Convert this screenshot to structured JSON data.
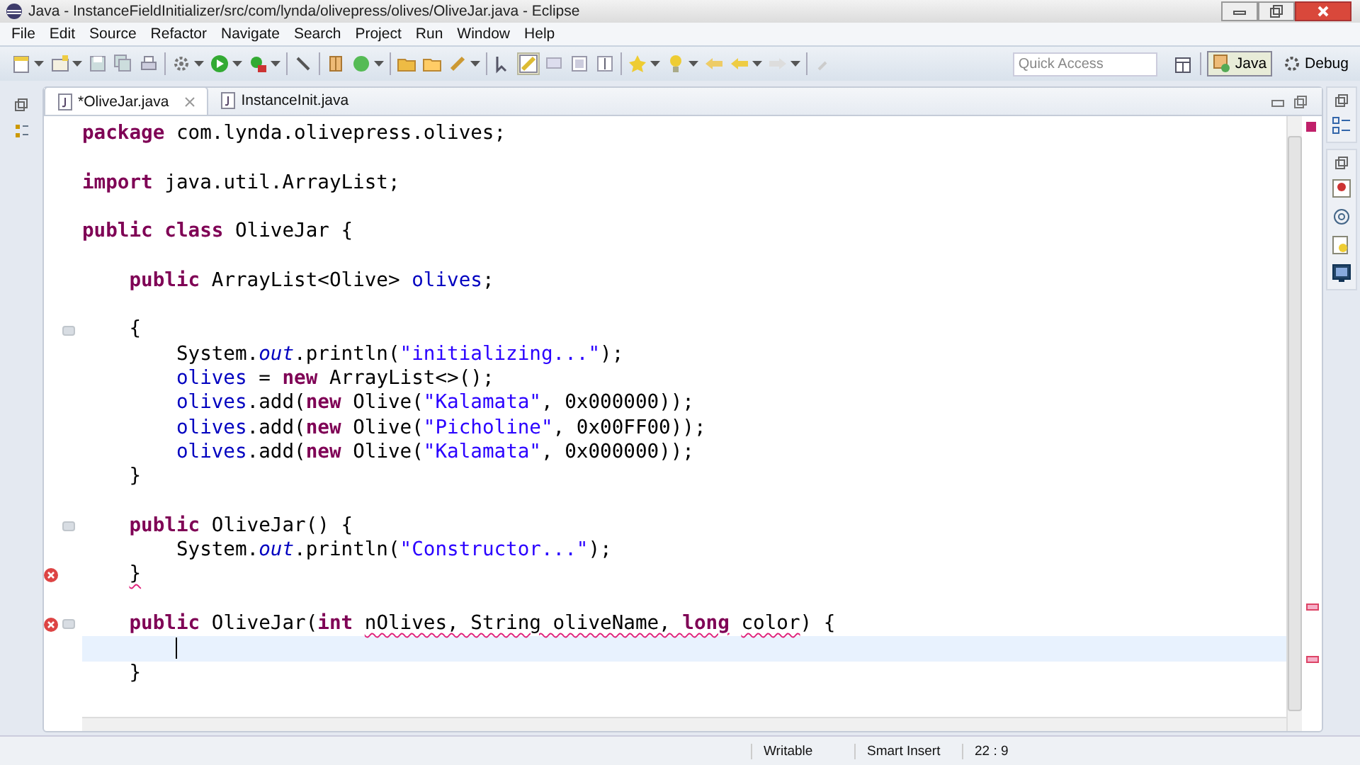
{
  "window": {
    "title": "Java - InstanceFieldInitializer/src/com/lynda/olivepress/olives/OliveJar.java - Eclipse"
  },
  "menu": [
    "File",
    "Edit",
    "Source",
    "Refactor",
    "Navigate",
    "Search",
    "Project",
    "Run",
    "Window",
    "Help"
  ],
  "quick_access": {
    "placeholder": "Quick Access"
  },
  "perspectives": [
    {
      "label": "Java",
      "selected": true
    },
    {
      "label": "Debug",
      "selected": false
    }
  ],
  "tabs": [
    {
      "label": "*OliveJar.java",
      "selected": true
    },
    {
      "label": "InstanceInit.java",
      "selected": false
    }
  ],
  "code_lines": [
    {
      "kind": "code",
      "fold": false,
      "error": false,
      "current": false,
      "tokens": [
        {
          "text": "package",
          "kind": "keyword"
        },
        {
          "text": " com.lynda.olivepress.olives;",
          "kind": "plain"
        }
      ]
    },
    {
      "kind": "blank"
    },
    {
      "kind": "code",
      "fold": false,
      "error": false,
      "current": false,
      "tokens": [
        {
          "text": "import",
          "kind": "keyword"
        },
        {
          "text": " java.util.ArrayList;",
          "kind": "plain"
        }
      ]
    },
    {
      "kind": "blank"
    },
    {
      "kind": "code",
      "fold": false,
      "error": false,
      "current": false,
      "tokens": [
        {
          "text": "public class",
          "kind": "keyword"
        },
        {
          "text": " OliveJar {",
          "kind": "plain"
        }
      ]
    },
    {
      "kind": "blank"
    },
    {
      "kind": "code",
      "fold": false,
      "error": false,
      "current": false,
      "tokens": [
        {
          "text": "    public",
          "kind": "keyword"
        },
        {
          "text": " ArrayList<Olive> ",
          "kind": "plain"
        },
        {
          "text": "olives",
          "kind": "field"
        },
        {
          "text": ";",
          "kind": "plain"
        }
      ]
    },
    {
      "kind": "blank"
    },
    {
      "kind": "code",
      "fold": true,
      "error": false,
      "current": false,
      "tokens": [
        {
          "text": "    {",
          "kind": "plain"
        }
      ]
    },
    {
      "kind": "code",
      "fold": false,
      "error": false,
      "current": false,
      "tokens": [
        {
          "text": "        System.",
          "kind": "plain"
        },
        {
          "text": "out",
          "kind": "static"
        },
        {
          "text": ".println(",
          "kind": "plain"
        },
        {
          "text": "\"initializing...\"",
          "kind": "string"
        },
        {
          "text": ");",
          "kind": "plain"
        }
      ]
    },
    {
      "kind": "code",
      "fold": false,
      "error": false,
      "current": false,
      "tokens": [
        {
          "text": "        olives",
          "kind": "field"
        },
        {
          "text": " = ",
          "kind": "plain"
        },
        {
          "text": "new",
          "kind": "keyword"
        },
        {
          "text": " ArrayList<>();",
          "kind": "plain"
        }
      ]
    },
    {
      "kind": "code",
      "fold": false,
      "error": false,
      "current": false,
      "tokens": [
        {
          "text": "        olives",
          "kind": "field"
        },
        {
          "text": ".add(",
          "kind": "plain"
        },
        {
          "text": "new",
          "kind": "keyword"
        },
        {
          "text": " Olive(",
          "kind": "plain"
        },
        {
          "text": "\"Kalamata\"",
          "kind": "string"
        },
        {
          "text": ", 0x000000));",
          "kind": "plain"
        }
      ]
    },
    {
      "kind": "code",
      "fold": false,
      "error": false,
      "current": false,
      "tokens": [
        {
          "text": "        olives",
          "kind": "field"
        },
        {
          "text": ".add(",
          "kind": "plain"
        },
        {
          "text": "new",
          "kind": "keyword"
        },
        {
          "text": " Olive(",
          "kind": "plain"
        },
        {
          "text": "\"Picholine\"",
          "kind": "string"
        },
        {
          "text": ", 0x00FF00));",
          "kind": "plain"
        }
      ]
    },
    {
      "kind": "code",
      "fold": false,
      "error": false,
      "current": false,
      "tokens": [
        {
          "text": "        olives",
          "kind": "field"
        },
        {
          "text": ".add(",
          "kind": "plain"
        },
        {
          "text": "new",
          "kind": "keyword"
        },
        {
          "text": " Olive(",
          "kind": "plain"
        },
        {
          "text": "\"Kalamata\"",
          "kind": "string"
        },
        {
          "text": ", 0x000000));",
          "kind": "plain"
        }
      ]
    },
    {
      "kind": "code",
      "fold": false,
      "error": false,
      "current": false,
      "tokens": [
        {
          "text": "    }",
          "kind": "plain"
        }
      ]
    },
    {
      "kind": "blank"
    },
    {
      "kind": "code",
      "fold": true,
      "error": false,
      "current": false,
      "tokens": [
        {
          "text": "    public",
          "kind": "keyword"
        },
        {
          "text": " OliveJar() {",
          "kind": "plain"
        }
      ]
    },
    {
      "kind": "code",
      "fold": false,
      "error": false,
      "current": false,
      "tokens": [
        {
          "text": "        System.",
          "kind": "plain"
        },
        {
          "text": "out",
          "kind": "static"
        },
        {
          "text": ".println(",
          "kind": "plain"
        },
        {
          "text": "\"Constructor...\"",
          "kind": "string"
        },
        {
          "text": ");",
          "kind": "plain"
        }
      ]
    },
    {
      "kind": "code",
      "fold": false,
      "error": true,
      "current": false,
      "tokens": [
        {
          "text": "    }",
          "kind": "plain",
          "squiggle": true
        }
      ]
    },
    {
      "kind": "blank"
    },
    {
      "kind": "code",
      "fold": true,
      "error": true,
      "current": false,
      "tokens": [
        {
          "text": "    public",
          "kind": "keyword"
        },
        {
          "text": " OliveJar(",
          "kind": "plain"
        },
        {
          "text": "int",
          "kind": "keyword"
        },
        {
          "text": " nOlives, String oliveName, ",
          "kind": "plain",
          "squiggle": true
        },
        {
          "text": "long",
          "kind": "keyword",
          "squiggle": true
        },
        {
          "text": " color",
          "kind": "plain",
          "squiggle": true
        },
        {
          "text": ") {",
          "kind": "plain"
        }
      ]
    },
    {
      "kind": "cursor",
      "fold": false,
      "error": false,
      "current": true
    },
    {
      "kind": "code",
      "fold": false,
      "error": false,
      "current": false,
      "tokens": [
        {
          "text": "    }",
          "kind": "plain"
        }
      ]
    }
  ],
  "status_bar": {
    "mode": "Writable",
    "insert": "Smart Insert",
    "position": "22 : 9"
  }
}
